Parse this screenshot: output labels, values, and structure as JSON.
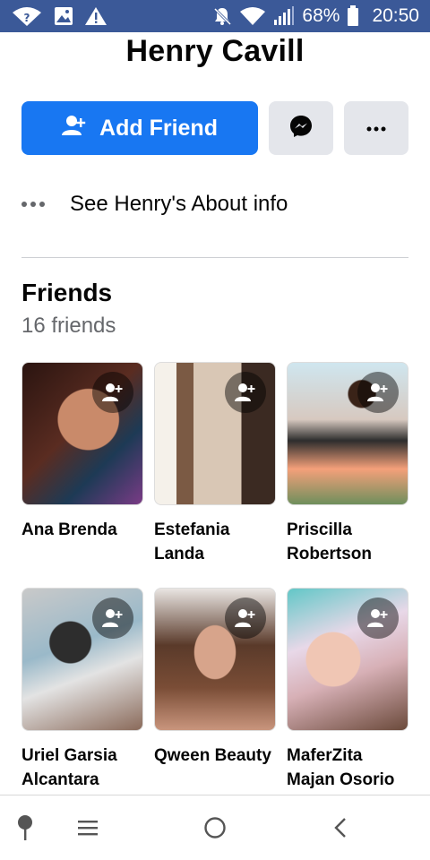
{
  "status_bar": {
    "battery_percent": "68%",
    "time": "20:50",
    "icons": [
      "wifi-question-icon",
      "image-icon",
      "warning-icon",
      "mute-icon",
      "wifi-icon",
      "signal-icon",
      "battery-icon"
    ]
  },
  "profile": {
    "name": "Henry Cavill"
  },
  "actions": {
    "add_friend_label": "Add Friend",
    "messenger_icon": "messenger-icon",
    "more_icon": "more-icon"
  },
  "about": {
    "label": "See Henry's About info"
  },
  "friends": {
    "title": "Friends",
    "count_label": "16 friends",
    "items": [
      {
        "name": "Ana Brenda"
      },
      {
        "name": "Estefania Landa"
      },
      {
        "name": "Priscilla Robertson"
      },
      {
        "name": "Uriel Garsia Alcantara"
      },
      {
        "name": "Qween Beauty"
      },
      {
        "name": "MaferZita Majan Osorio"
      }
    ]
  },
  "navigation": {
    "icons": [
      "pin-icon",
      "menu-icon",
      "home-circle-icon",
      "back-icon"
    ]
  },
  "colors": {
    "status_bar": "#3b5998",
    "primary": "#1877f2",
    "secondary_button": "#e4e6eb",
    "muted_text": "#65676b"
  }
}
